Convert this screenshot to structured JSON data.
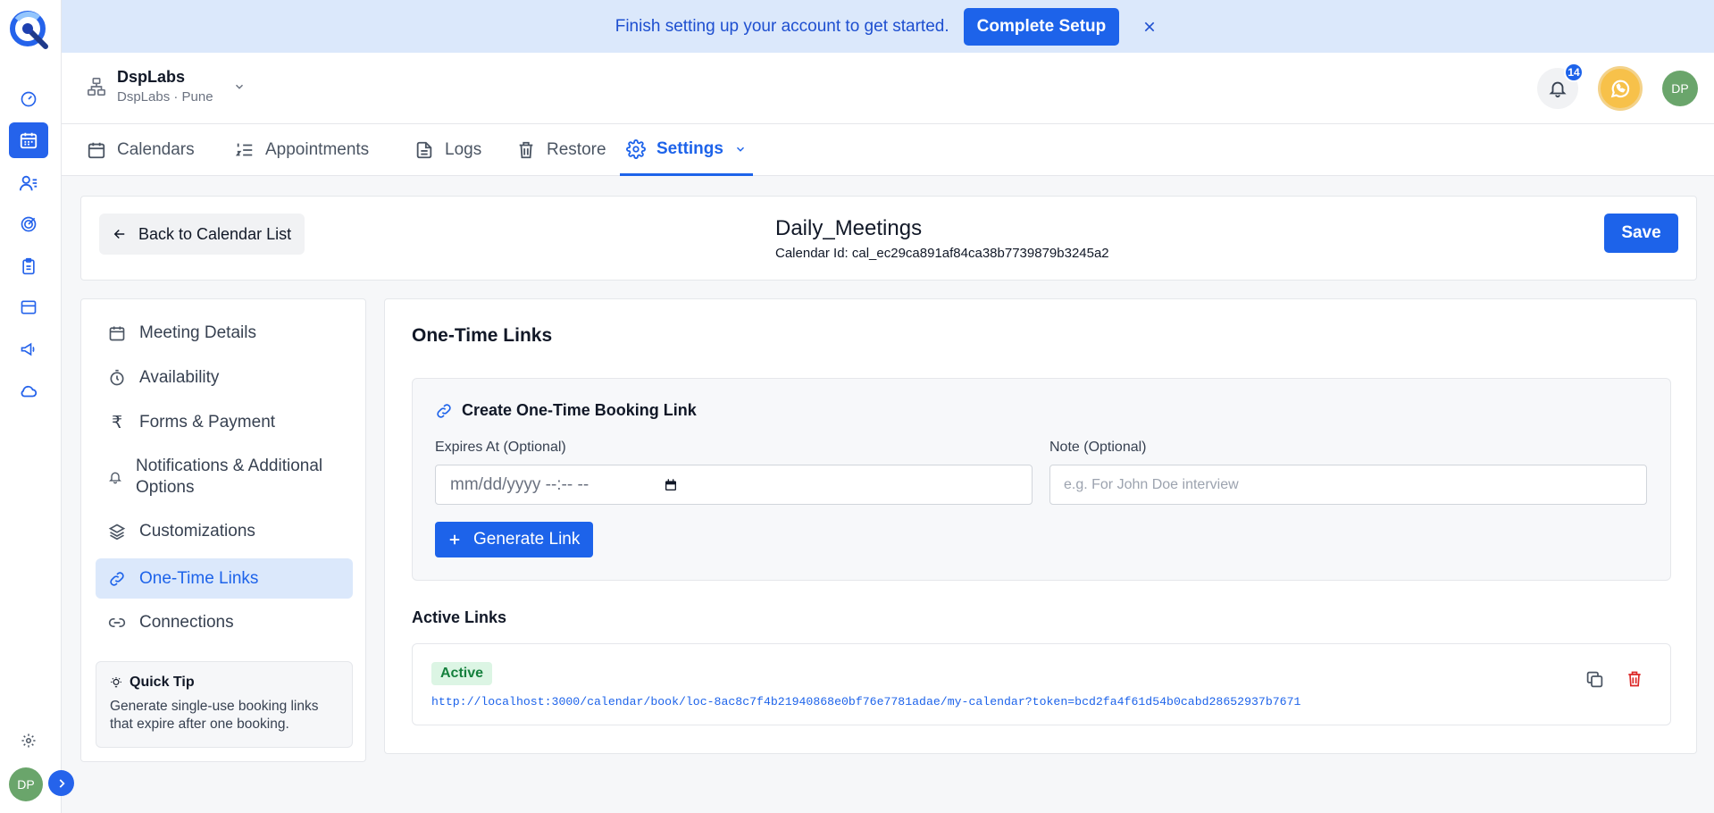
{
  "banner": {
    "text": "Finish setting up your account to get started.",
    "button": "Complete Setup"
  },
  "org": {
    "name": "DspLabs",
    "sub": "DspLabs · Pune"
  },
  "header": {
    "notifications_count": "14",
    "avatar_initials": "DP"
  },
  "tabs": [
    {
      "label": "Calendars",
      "icon": "calendar-icon"
    },
    {
      "label": "Appointments",
      "icon": "list-ordered-icon"
    },
    {
      "label": "Logs",
      "icon": "file-text-icon"
    },
    {
      "label": "Restore",
      "icon": "trash-icon"
    },
    {
      "label": "Settings",
      "icon": "gear-icon",
      "active": true
    }
  ],
  "title_card": {
    "back_label": "Back to Calendar List",
    "calendar_name": "Daily_Meetings",
    "calendar_id": "Calendar Id: cal_ec29ca891af84ca38b7739879b3245a2",
    "save_label": "Save"
  },
  "side_menu": {
    "items": [
      {
        "label": "Meeting Details",
        "icon": "calendar-icon"
      },
      {
        "label": "Availability",
        "icon": "stopwatch-icon"
      },
      {
        "label": "Forms & Payment",
        "icon": "rupee-icon"
      },
      {
        "label": "Notifications & Additional Options",
        "icon": "bell-icon"
      },
      {
        "label": "Customizations",
        "icon": "layers-icon"
      },
      {
        "label": "One-Time Links",
        "icon": "link-icon",
        "active": true
      },
      {
        "label": "Connections",
        "icon": "chain-link-icon"
      }
    ],
    "tip_title": "Quick Tip",
    "tip_text": "Generate single-use booking links that expire after one booking."
  },
  "main": {
    "title": "One-Time Links",
    "create_title": "Create One-Time Booking Link",
    "expires_label": "Expires At (Optional)",
    "expires_value": "mm/dd/yyyy --:-- --",
    "note_label": "Note (Optional)",
    "note_placeholder": "e.g. For John Doe interview",
    "generate_label": "Generate Link",
    "active_title": "Active Links",
    "links": [
      {
        "status": "Active",
        "url": "http://localhost:3000/calendar/book/loc-8ac8c7f4b21940868e0bf76e7781adae/my-calendar?token=bcd2fa4f61d54b0cabd28652937b7671"
      }
    ]
  },
  "rail": {
    "avatar_initials": "DP"
  },
  "colors": {
    "accent": "#1d63ea",
    "banner_bg": "#dbe8fb",
    "active_badge_bg": "#dcf5e4",
    "danger": "#dc2626",
    "avatar": "#6aa56b"
  }
}
